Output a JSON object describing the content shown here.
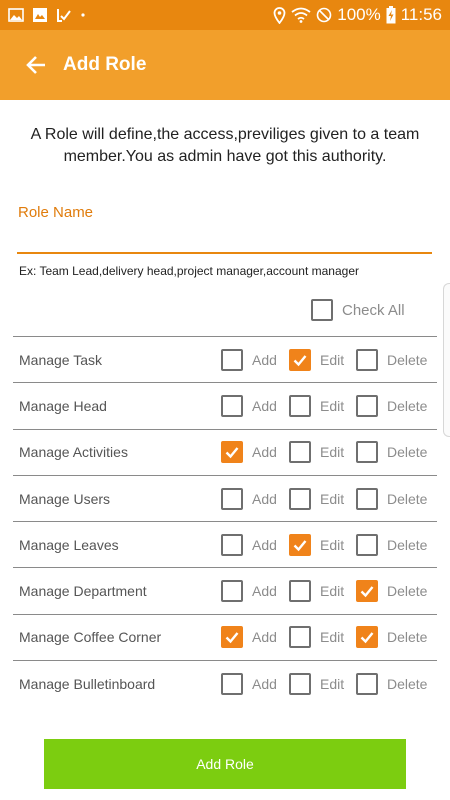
{
  "status_bar": {
    "battery": "100%",
    "time": "11:56",
    "left_icons": [
      "gallery-icon",
      "image-icon",
      "signal-app-icon",
      "dot-icon"
    ],
    "right_icons": [
      "location-icon",
      "wifi-icon",
      "do-not-disturb-icon",
      "battery-charging-icon"
    ]
  },
  "app_bar": {
    "title": "Add Role",
    "back_icon": "arrow-left-icon",
    "background": "#f29f2b"
  },
  "intro_text": "A Role will define,the access,previliges given to a team member.You as admin have got this authority.",
  "role_field": {
    "label": "Role Name",
    "value": "",
    "placeholder": "",
    "hint": "Ex: Team Lead,delivery head,project manager,account manager"
  },
  "check_all": {
    "label": "Check All",
    "checked": false
  },
  "column_labels": {
    "add": "Add",
    "edit": "Edit",
    "delete": "Delete"
  },
  "permissions": [
    {
      "name": "Manage Task",
      "add": false,
      "edit": true,
      "delete": false
    },
    {
      "name": "Manage Head",
      "add": false,
      "edit": false,
      "delete": false
    },
    {
      "name": "Manage Activities",
      "add": true,
      "edit": false,
      "delete": false
    },
    {
      "name": "Manage Users",
      "add": false,
      "edit": false,
      "delete": false
    },
    {
      "name": "Manage Leaves",
      "add": false,
      "edit": true,
      "delete": false
    },
    {
      "name": "Manage Department",
      "add": false,
      "edit": false,
      "delete": true
    },
    {
      "name": "Manage Coffee Corner",
      "add": true,
      "edit": false,
      "delete": true
    },
    {
      "name": "Manage Bulletinboard",
      "add": false,
      "edit": false,
      "delete": false
    }
  ],
  "submit_label": "Add Role",
  "colors": {
    "accent": "#f0831a",
    "status_bar": "#e8870f",
    "submit": "#7ccd10"
  }
}
